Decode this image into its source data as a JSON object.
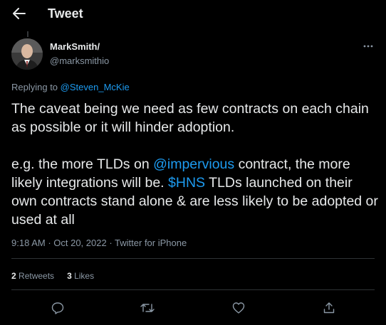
{
  "header": {
    "title": "Tweet",
    "back_icon": "arrow-left-icon"
  },
  "author": {
    "display_name": "MarkSmith/",
    "handle": "@marksmithio",
    "avatar_icon": "profile-photo"
  },
  "reply": {
    "prefix": "Replying to",
    "to": "@Steven_McKie"
  },
  "tweet": {
    "para1": "The caveat being we need as few contracts on each chain as possible or it will hinder adoption.",
    "para2_a": "e.g. the more TLDs on ",
    "mention": "@impervious",
    "para2_b": " contract, the more likely integrations will be. ",
    "cashtag": "$HNS",
    "para2_c": " TLDs launched on their own contracts stand alone & are less likely to be adopted or used at all"
  },
  "meta": {
    "time": "9:18 AM",
    "date": "Oct 20, 2022",
    "sep": " · ",
    "source": "Twitter for iPhone"
  },
  "stats": {
    "retweets_count": "2",
    "retweets_label": "Retweets",
    "likes_count": "3",
    "likes_label": "Likes"
  },
  "actions": {
    "reply_icon": "reply-icon",
    "retweet_icon": "retweet-icon",
    "like_icon": "like-icon",
    "share_icon": "share-icon"
  },
  "colors": {
    "background": "#000000",
    "text": "#e7e9ea",
    "secondary": "#8b98a5",
    "accent": "#1d9bf0",
    "divider": "#2f3336"
  }
}
